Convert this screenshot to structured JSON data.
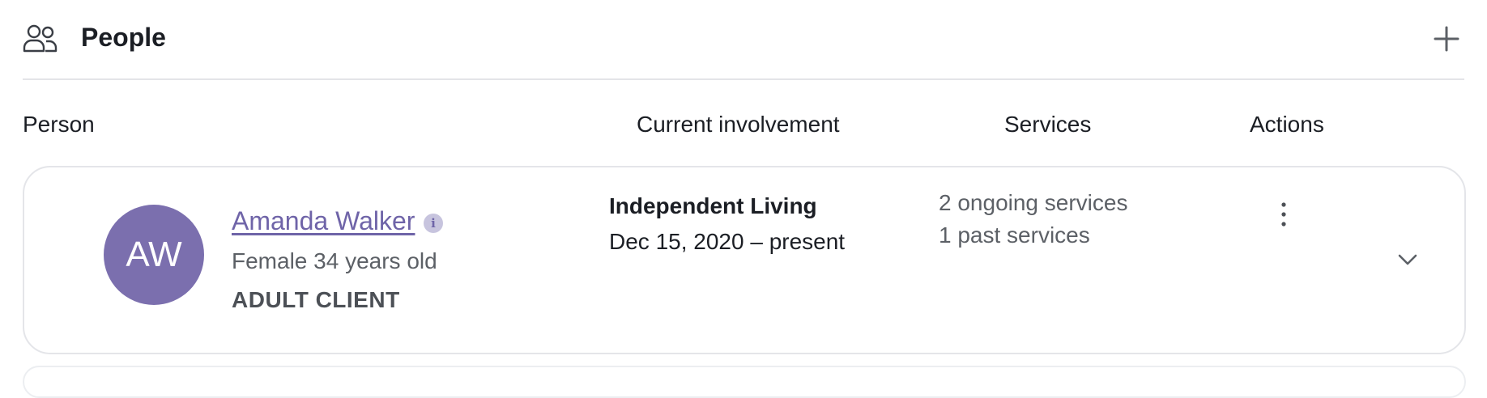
{
  "header": {
    "title": "People",
    "icon": "people-icon",
    "add_icon": "plus-icon"
  },
  "table": {
    "columns": {
      "person": "Person",
      "involvement": "Current involvement",
      "services": "Services",
      "actions": "Actions"
    }
  },
  "rows": [
    {
      "initials": "AW",
      "avatar_color": "#7b6fae",
      "name": "Amanda Walker",
      "info_glyph": "i",
      "meta": "Female 34 years old",
      "type": "ADULT CLIENT",
      "involvement_title": "Independent Living",
      "involvement_dates": "Dec 15, 2020 – present",
      "services": [
        "2 ongoing services",
        "1 past services"
      ],
      "actions_icon": "more-vertical-icon",
      "expand_icon": "chevron-down-icon"
    }
  ],
  "colors": {
    "accent": "#6f64a8",
    "border": "#e4e5e9"
  }
}
